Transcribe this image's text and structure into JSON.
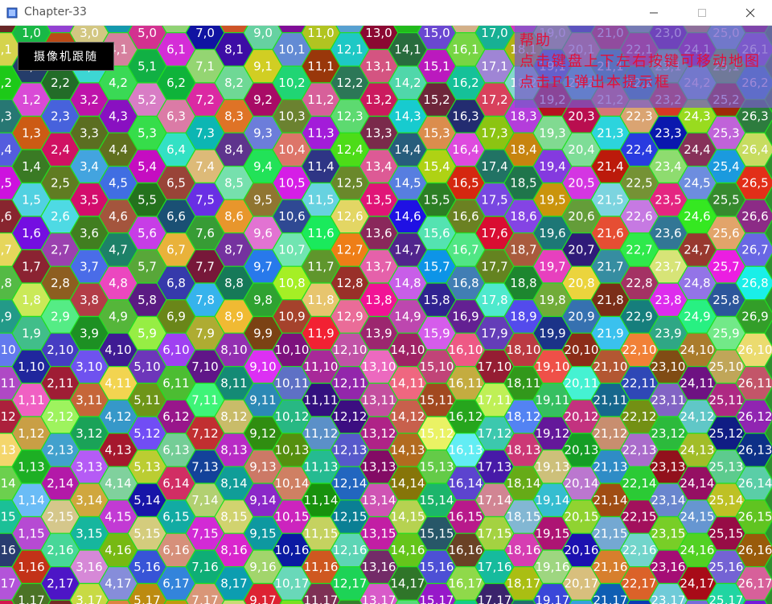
{
  "window": {
    "title": "Chapter-33",
    "controls": {
      "minimize_icon": "minimize-icon",
      "maximize_icon": "maximize-icon",
      "close_icon": "close-icon"
    }
  },
  "camera_button": {
    "label": "摄像机跟随"
  },
  "help": {
    "title": "帮助",
    "lines": [
      "点击键盘上下左右按键可移动地图",
      "点击F1弹出本提示框"
    ]
  },
  "map": {
    "columns": 27,
    "rows": 19,
    "label_format": "col,row",
    "hex_border_color": "#20e020",
    "label_color": "#ffffff"
  }
}
